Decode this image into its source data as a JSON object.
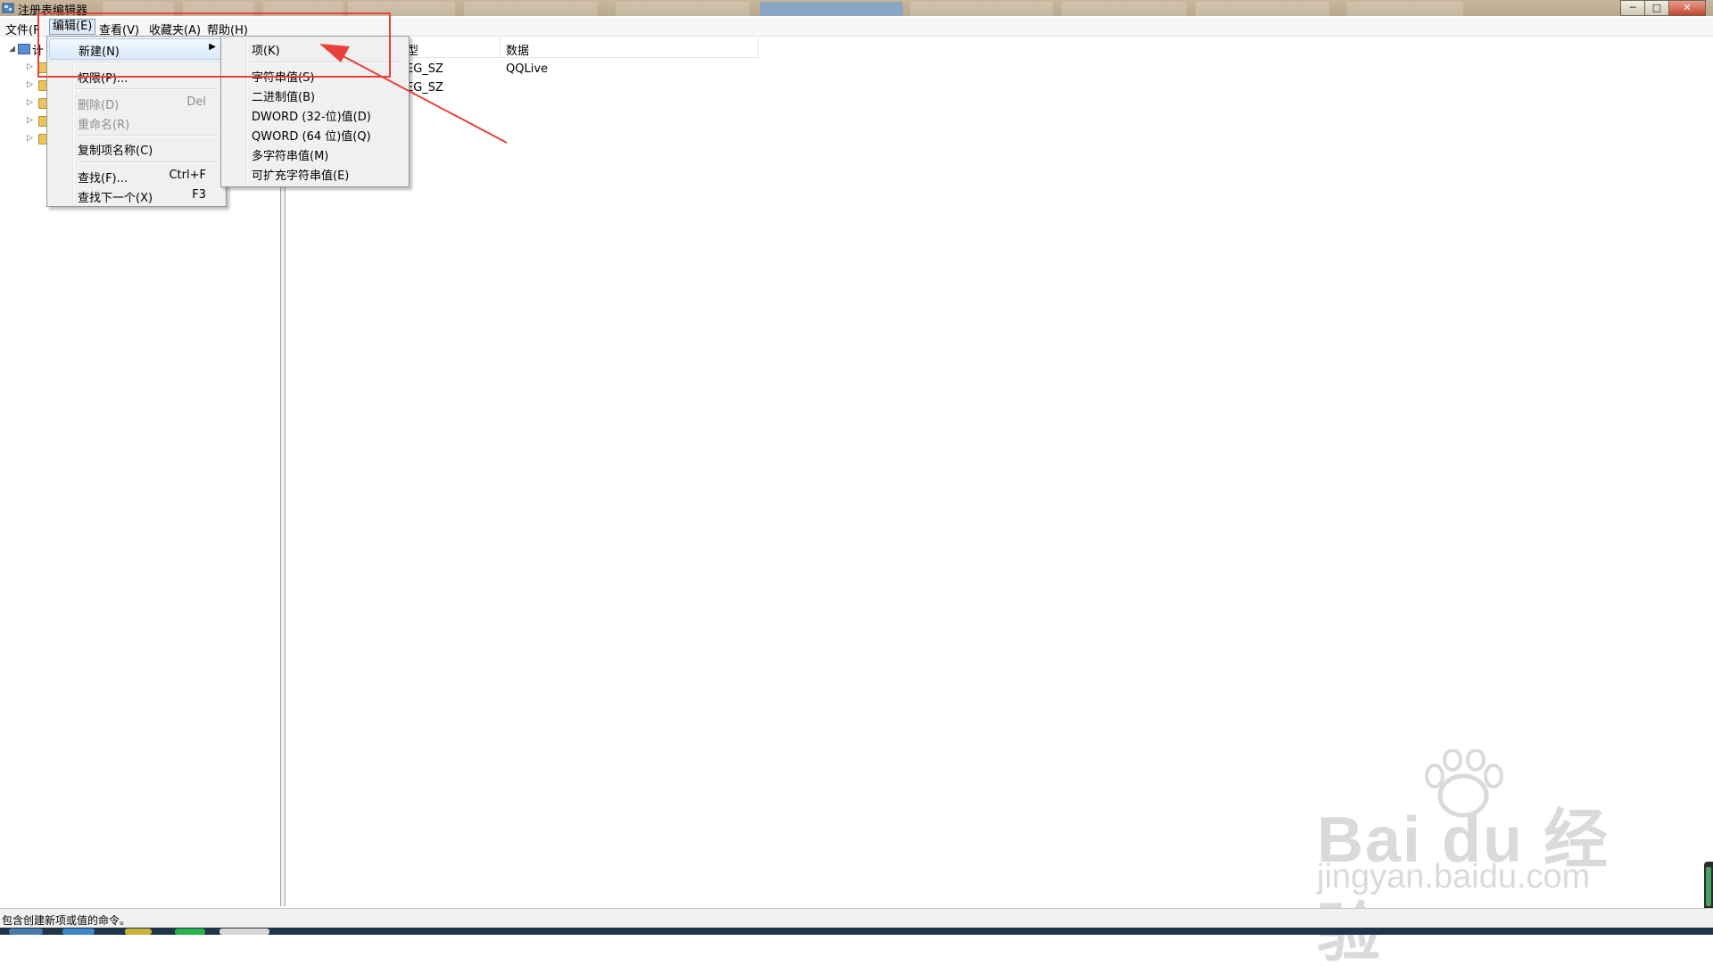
{
  "window": {
    "title": "注册表编辑器",
    "controls": {
      "minimize": "─",
      "maximize": "□",
      "close": "✕"
    }
  },
  "menubar": {
    "file": "文件(F",
    "edit": "编辑(E)",
    "view": "查看(V)",
    "favorites": "收藏夹(A)",
    "help": "帮助(H)"
  },
  "tree": {
    "root_label": "计"
  },
  "list": {
    "columns": {
      "type": "型",
      "data": "数据"
    },
    "rows": [
      {
        "type": "EG_SZ",
        "data": "QQLive"
      },
      {
        "type": "EG_SZ",
        "data": ""
      }
    ]
  },
  "edit_menu": {
    "items": [
      {
        "label": "新建(N)",
        "shortcut": "",
        "disabled": false,
        "submenu": true
      },
      {
        "label": "权限(P)...",
        "shortcut": "",
        "disabled": false
      },
      {
        "label": "删除(D)",
        "shortcut": "Del",
        "disabled": true
      },
      {
        "label": "重命名(R)",
        "shortcut": "",
        "disabled": true
      },
      {
        "label": "复制项名称(C)",
        "shortcut": "",
        "disabled": false
      },
      {
        "label": "查找(F)...",
        "shortcut": "Ctrl+F",
        "disabled": false
      },
      {
        "label": "查找下一个(X)",
        "shortcut": "F3",
        "disabled": false
      }
    ]
  },
  "new_submenu": {
    "items": [
      "项(K)",
      "字符串值(S)",
      "二进制值(B)",
      "DWORD (32-位)值(D)",
      "QWORD (64 位)值(Q)",
      "多字符串值(M)",
      "可扩充字符串值(E)"
    ]
  },
  "status": {
    "text": "包含创建新项或值的命令。"
  },
  "watermark": {
    "brand": "Bai du 经验",
    "url": "jingyan.baidu.com"
  },
  "colors": {
    "annotation": "#e8413a",
    "menu_highlight": "#dbeafc"
  }
}
